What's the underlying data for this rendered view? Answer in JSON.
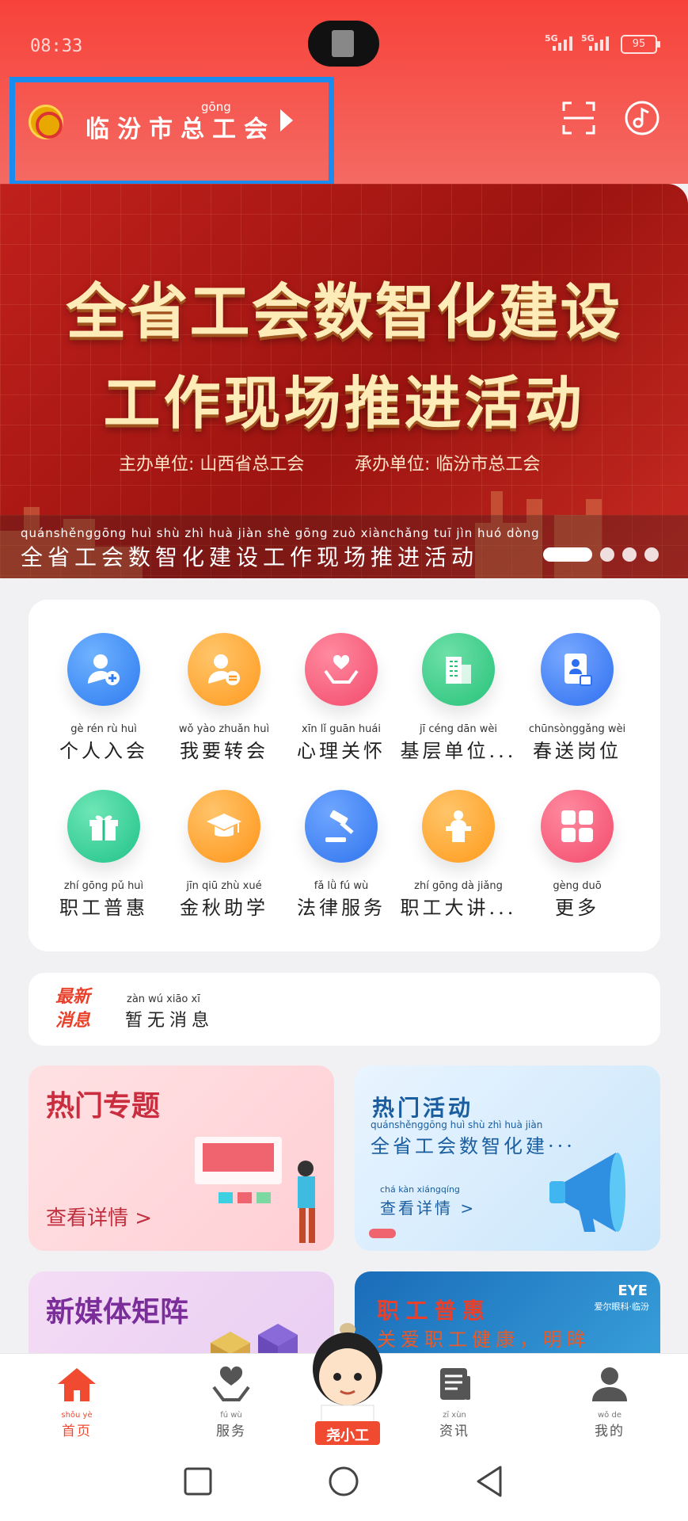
{
  "status_bar": {
    "time": "08:33",
    "signal1": "5G",
    "signal2": "5G",
    "battery": "95"
  },
  "header": {
    "org_name": "临汾市总工会",
    "org_name_pinyin_hint": "gōng",
    "scan_icon": "scan-icon",
    "music_icon": "music-icon"
  },
  "banner": {
    "title_line1": "全省工会数智化建设",
    "title_line2": "工作现场推进活动",
    "organizer": "主办单位: 山西省总工会",
    "co_organizer": "承办单位: 临汾市总工会",
    "caption_pinyin": "quánshěnggōng huì  shù  zhì  huà  jiàn  shè gōng zuò  xiànchǎng tuī   jìn  huó dòng",
    "caption": "全省工会数智化建设工作现场推进活动",
    "slide_count": 4,
    "active_slide": 1
  },
  "services": [
    {
      "pinyin": "gè  rén  rù  huì",
      "label": "个人入会",
      "icon": "person-add-icon",
      "color": "#2d7bf0"
    },
    {
      "pinyin": "wǒ  yào zhuǎn huì",
      "label": "我要转会",
      "icon": "person-transfer-icon",
      "color": "#ff9a1f"
    },
    {
      "pinyin": "xīn   lǐ  guān huái",
      "label": "心理关怀",
      "icon": "heart-hands-icon",
      "color": "#f24a6a"
    },
    {
      "pinyin": "jī  céng dān  wèi",
      "label": "基层单位...",
      "icon": "building-icon",
      "color": "#27c27a"
    },
    {
      "pinyin": "chūnsònggǎng wèi",
      "label": "春送岗位",
      "icon": "id-card-icon",
      "color": "#2d6ff0"
    },
    {
      "pinyin": "zhí gōng pǔ  huì",
      "label": "职工普惠",
      "icon": "gift-icon",
      "color": "#20c28a"
    },
    {
      "pinyin": "jīn  qiū  zhù  xué",
      "label": "金秋助学",
      "icon": "graduation-cap-icon",
      "color": "#ff9418"
    },
    {
      "pinyin": "fǎ   lǜ   fú   wù",
      "label": "法律服务",
      "icon": "gavel-icon",
      "color": "#2f74ee"
    },
    {
      "pinyin": "zhí gōng dà  jiǎng",
      "label": "职工大讲...",
      "icon": "lectern-icon",
      "color": "#ff9a1a"
    },
    {
      "pinyin": "gèng duō",
      "label": "更多",
      "icon": "grid-more-icon",
      "color": "#f24a6a"
    }
  ],
  "news": {
    "tag_line1": "最新",
    "tag_line2": "消息",
    "pinyin": "zàn  wú  xiāo  xī",
    "text": "暂无消息"
  },
  "promos": {
    "hot_topic": {
      "title": "热门专题",
      "link": "查看详情 >"
    },
    "hot_activity": {
      "title": "热门活动",
      "sub_pinyin": "quánshěnggōng huì  shù  zhì  huà  jiàn",
      "subtitle": "全省工会数智化建···",
      "link_pinyin": "chá  kàn xiángqíng",
      "link": "查看详情 >"
    },
    "new_media": {
      "title": "新媒体矩阵"
    },
    "benefit": {
      "title": "职工普惠",
      "subtitle": "关爱职工健康，明眸",
      "brand_logo": "EYE",
      "brand": "爱尔眼科·临汾"
    }
  },
  "tabbar": [
    {
      "pinyin": "shǒu  yè",
      "label": "首页",
      "icon": "home-icon",
      "active": true
    },
    {
      "pinyin": "fú   wù",
      "label": "服务",
      "icon": "heart-hand-icon",
      "active": false
    },
    {
      "pinyin": "",
      "label": "尧小工",
      "icon": "mascot-icon",
      "active": false
    },
    {
      "pinyin": "zī  xùn",
      "label": "资讯",
      "icon": "news-doc-icon",
      "active": false
    },
    {
      "pinyin": "wǒ  de",
      "label": "我的",
      "icon": "profile-icon",
      "active": false
    }
  ],
  "colors": {
    "primary": "#f7423a",
    "active_tab": "#f04a30"
  }
}
